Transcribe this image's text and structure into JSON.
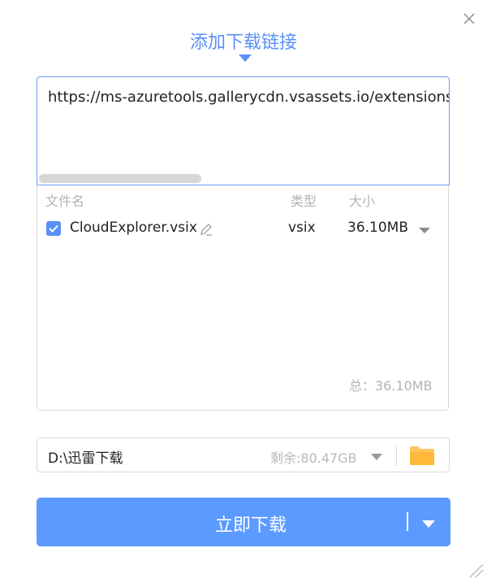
{
  "dialog": {
    "title": "添加下载链接"
  },
  "url_input": {
    "value": "https://ms-azuretools.gallerycdn.vsassets.io/extensions/ms-azuretools/vscode-azure..."
  },
  "file_table": {
    "headers": {
      "name": "文件名",
      "type": "类型",
      "size": "大小"
    },
    "rows": [
      {
        "checked": true,
        "name": "CloudExplorer.vsix",
        "type": "vsix",
        "size": "36.10MB"
      }
    ],
    "total": "总：36.10MB"
  },
  "save_path": {
    "path": "D:\\迅雷下载",
    "free_space": "剩余:80.47GB"
  },
  "download_button": {
    "label": "立即下载"
  },
  "colors": {
    "accent": "#5b8ff9",
    "button": "#5b9bff",
    "folder": "#ffc65c"
  },
  "icons": [
    "close-icon",
    "edit-icon",
    "folder-icon",
    "chevron-down-icon",
    "resize-grip-icon",
    "check-icon"
  ]
}
